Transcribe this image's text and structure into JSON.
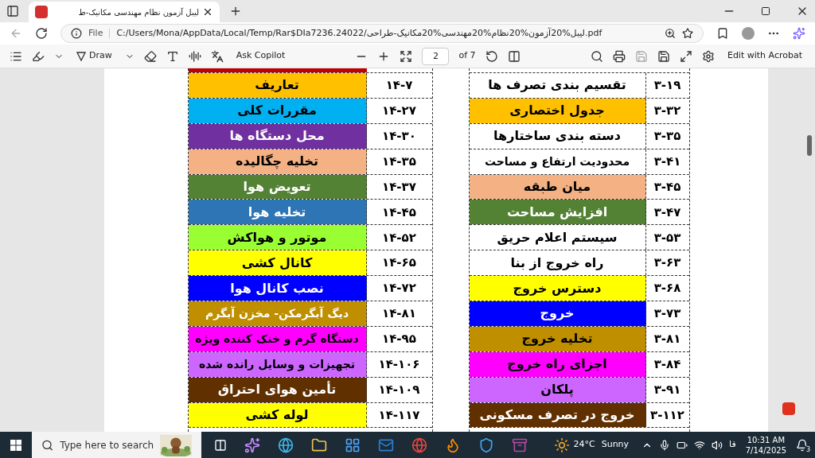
{
  "browser": {
    "tab_title": "لیبل آزمون نظام مهندسی مکانیک-ط",
    "address_prefix": "File",
    "address": "C:/Users/Mona/AppData/Local/Temp/Rar$DIa7236.24022/لیبل%20آزمون%20نظام%20مهندسی%20مکانیک-طراحی.pdf"
  },
  "pdf_toolbar": {
    "draw_label": "Draw",
    "copilot_label": "Ask Copilot",
    "page": "2",
    "page_count": "of 7",
    "acrobat_label": "Edit with Acrobat"
  },
  "tables": [
    {
      "rows": [
        {
          "title": "تقسیم بندی تصرف ها",
          "code": "۳-۱۹",
          "color": "#ffffff",
          "light_text": false
        },
        {
          "title": "جدول اختصاری",
          "code": "۳-۳۲",
          "color": "#ffc000",
          "light_text": false
        },
        {
          "title": "دسته بندی ساختارها",
          "code": "۳-۳۵",
          "color": "#ffffff",
          "light_text": false
        },
        {
          "title": "محدودیت ارتفاع و مساحت",
          "code": "۳-۴۱",
          "color": "#ffffff",
          "light_text": false
        },
        {
          "title": "میان طبقه",
          "code": "۳-۴۵",
          "color": "#f4b183",
          "light_text": false
        },
        {
          "title": "افزایش مساحت",
          "code": "۳-۴۷",
          "color": "#548235",
          "light_text": true
        },
        {
          "title": "سیستم اعلام حریق",
          "code": "۳-۵۳",
          "color": "#ffffff",
          "light_text": false
        },
        {
          "title": "راه خروج از بنا",
          "code": "۳-۶۳",
          "color": "#ffffff",
          "light_text": false
        },
        {
          "title": "دسترس خروج",
          "code": "۳-۶۸",
          "color": "#ffff00",
          "light_text": false
        },
        {
          "title": "خروج",
          "code": "۳-۷۳",
          "color": "#0000ff",
          "light_text": true
        },
        {
          "title": "تخلیه خروج",
          "code": "۳-۸۱",
          "color": "#bf8f00",
          "light_text": false
        },
        {
          "title": "اجزای راه خروج",
          "code": "۳-۸۴",
          "color": "#ff00ff",
          "light_text": false
        },
        {
          "title": "پلکان",
          "code": "۳-۹۱",
          "color": "#cc66ff",
          "light_text": false
        },
        {
          "title": "خروج در تصرف مسکونی",
          "code": "۳-۱۱۲",
          "color": "#603000",
          "light_text": true
        }
      ]
    },
    {
      "top_strip": {
        "color": "#c00000"
      },
      "rows": [
        {
          "title": "تعاریف",
          "code": "۱۴-۷",
          "color": "#ffc000",
          "light_text": false
        },
        {
          "title": "مقررات کلی",
          "code": "۱۴-۲۷",
          "color": "#00b0f0",
          "light_text": false
        },
        {
          "title": "محل دستگاه ها",
          "code": "۱۴-۳۰",
          "color": "#7030a0",
          "light_text": true
        },
        {
          "title": "تخلیه چگالیده",
          "code": "۱۴-۳۵",
          "color": "#f4b183",
          "light_text": false
        },
        {
          "title": "تعویض هوا",
          "code": "۱۴-۳۷",
          "color": "#548235",
          "light_text": true
        },
        {
          "title": "تخلیه هوا",
          "code": "۱۴-۴۵",
          "color": "#2e75b6",
          "light_text": true
        },
        {
          "title": "موتور و هواکش",
          "code": "۱۴-۵۲",
          "color": "#99ff33",
          "light_text": false
        },
        {
          "title": "کانال کشی",
          "code": "۱۴-۶۵",
          "color": "#ffff00",
          "light_text": false
        },
        {
          "title": "نصب کانال هوا",
          "code": "۱۴-۷۲",
          "color": "#0000ff",
          "light_text": true
        },
        {
          "title": "دیگ آبگرمکن- مخزن آبگرم",
          "code": "۱۴-۸۱",
          "color": "#bf8f00",
          "light_text": true
        },
        {
          "title": "دستگاه گرم و خنک کننده ویژه",
          "code": "۱۴-۹۵",
          "color": "#ff00ff",
          "light_text": false
        },
        {
          "title": "تجهیزات و وسایل رانده شده",
          "code": "۱۴-۱۰۶",
          "color": "#cc66ff",
          "light_text": false
        },
        {
          "title": "تأمین هوای احتراق",
          "code": "۱۴-۱۰۹",
          "color": "#603000",
          "light_text": true
        },
        {
          "title": "لوله کشی",
          "code": "۱۴-۱۱۷",
          "color": "#ffff00",
          "light_text": false
        }
      ]
    }
  ],
  "taskbar": {
    "search_placeholder": "Type here to search",
    "weather": "24°C",
    "weather_text": "Sunny",
    "language": "فا",
    "time": "10:31 AM",
    "date": "7/14/2025",
    "notifications": "3"
  }
}
